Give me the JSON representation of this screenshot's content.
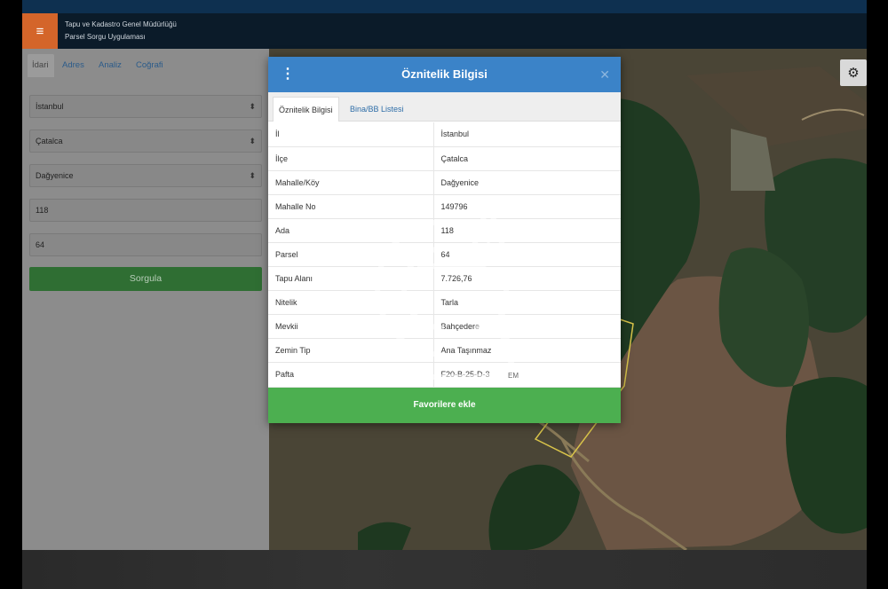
{
  "header": {
    "line1": "Tapu ve Kadastro Genel Müdürlüğü",
    "line2": "Parsel Sorgu Uygulaması"
  },
  "sidebar": {
    "tabs": [
      "İdari",
      "Adres",
      "Analiz",
      "Coğrafi"
    ],
    "il": "İstanbul",
    "ilce": "Çatalca",
    "mahalle": "Dağyenice",
    "ada": "118",
    "parsel": "64",
    "query_button": "Sorgula"
  },
  "modal": {
    "title": "Öznitelik Bilgisi",
    "tabs": [
      "Öznitelik Bilgisi",
      "Bina/BB Listesi"
    ],
    "rows": [
      {
        "key": "İl",
        "value": "İstanbul"
      },
      {
        "key": "İlçe",
        "value": "Çatalca"
      },
      {
        "key": "Mahalle/Köy",
        "value": "Dağyenice"
      },
      {
        "key": "Mahalle No",
        "value": "149796"
      },
      {
        "key": "Ada",
        "value": "118"
      },
      {
        "key": "Parsel",
        "value": "64"
      },
      {
        "key": "Tapu Alanı",
        "value": "7.726,76"
      },
      {
        "key": "Nitelik",
        "value": "Tarla"
      },
      {
        "key": "Mevkii",
        "value": "Bahçedere"
      },
      {
        "key": "Zemin Tip",
        "value": "Ana Taşınmaz"
      },
      {
        "key": "Pafta",
        "value": "F20-B-25-D-3"
      }
    ],
    "favorite_button": "Favorilere ekle"
  },
  "watermark": {
    "badge": "EM"
  },
  "icons": {
    "menu": "hamburger-icon",
    "settings": "gear-icon",
    "close": "close-icon",
    "more": "kebab-icon"
  },
  "colors": {
    "accent_orange": "#d4652a",
    "modal_header": "#3b83c8",
    "favorite_green": "#4caf50",
    "query_green": "#2f6e33"
  }
}
